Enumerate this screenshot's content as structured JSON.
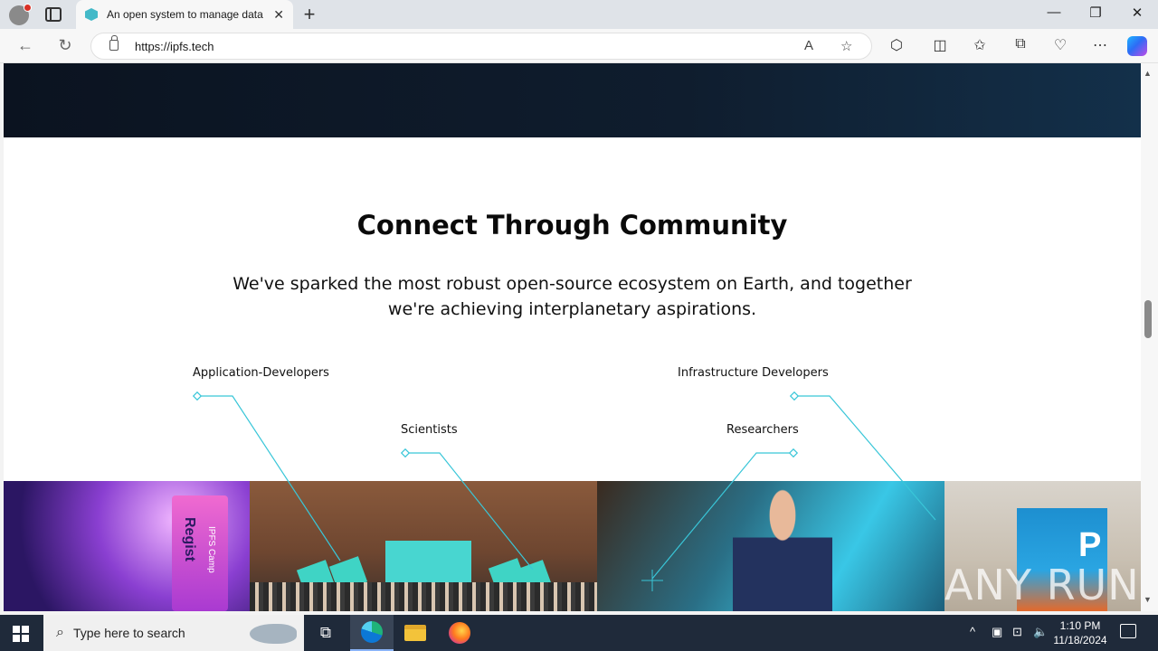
{
  "browser": {
    "tab_title": "An open system to manage data",
    "tab_close": "✕",
    "new_tab": "+",
    "url": "https://ipfs.tech",
    "window_controls": {
      "minimize": "—",
      "restore": "❐",
      "close": "✕"
    },
    "nav": {
      "back": "←",
      "refresh": "↻"
    },
    "toolbar_icons": {
      "read_aloud": "A",
      "favorite": "☆",
      "extensions": "⬡",
      "split": "◫",
      "favorites": "✩",
      "collections": "⧉",
      "performance": "♡",
      "more": "⋯"
    }
  },
  "page": {
    "headline": "Connect Through Community",
    "subline": "We've sparked the most robust open-source ecosystem on Earth, and together we're achieving interplanetary aspirations.",
    "roles": {
      "application_developers": "Application-Developers",
      "infrastructure_developers": "Infrastructure Developers",
      "scientists": "Scientists",
      "researchers": "Researchers"
    },
    "photo1_panel_text": "Regist",
    "photo1_panel_text2": "IPFS Camp",
    "photo4_text": "P",
    "watermark": "ANY RUN"
  },
  "scrollbar": {
    "up": "▲",
    "down": "▼"
  },
  "taskbar": {
    "search_placeholder": "Type here to search",
    "search_icon": "⌕",
    "taskview_icon": "⧉",
    "tray": {
      "chevron": "^",
      "battery": "▣",
      "network": "⊡",
      "volume": "🔈"
    },
    "time": "1:10 PM",
    "date": "11/18/2024"
  }
}
